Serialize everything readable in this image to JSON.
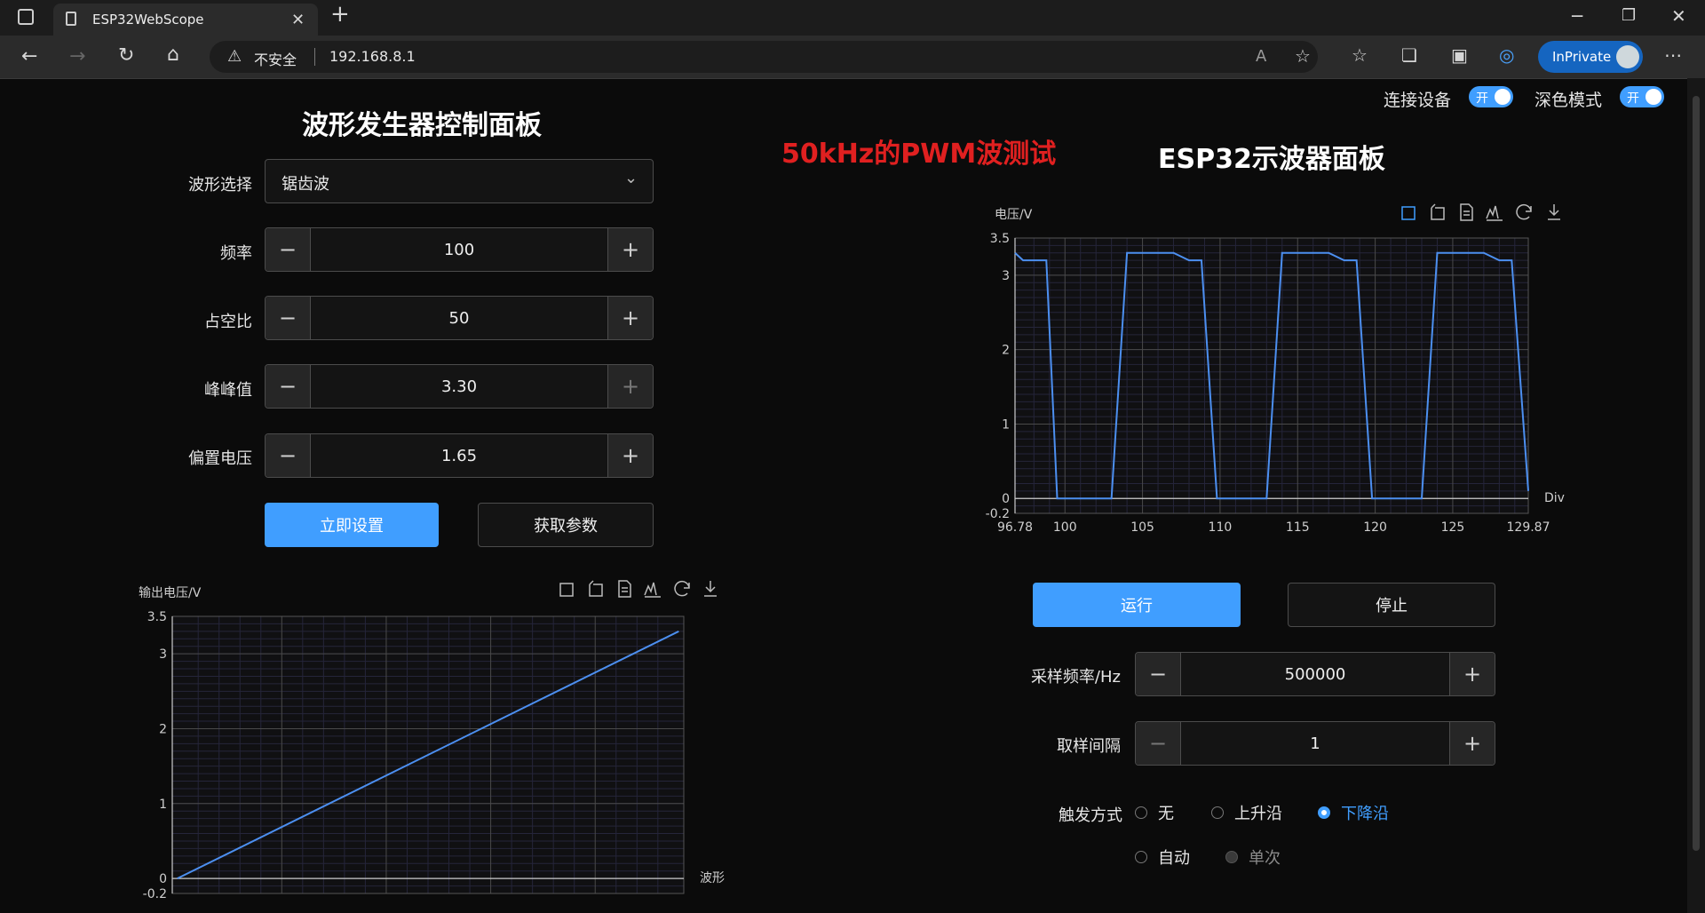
{
  "browser": {
    "tab_title": "ESP32WebScope",
    "new_tab": "+",
    "insecure_label": "不安全",
    "url": "192.168.8.1",
    "inprivate_label": "InPrivate"
  },
  "header": {
    "connect_label": "连接设备",
    "connect_toggle": "开",
    "dark_label": "深色模式",
    "dark_toggle": "开"
  },
  "annotation": {
    "text": "50kHz的PWM波测试",
    "color": "#e02020"
  },
  "generator": {
    "title": "波形发生器控制面板",
    "waveform_label": "波形选择",
    "waveform_value": "锯齿波",
    "freq_label": "频率",
    "freq_value": "100",
    "duty_label": "占空比",
    "duty_value": "50",
    "vpp_label": "峰峰值",
    "vpp_value": "3.30",
    "offset_label": "偏置电压",
    "offset_value": "1.65",
    "apply_button": "立即设置",
    "fetch_button": "获取参数",
    "minus": "−",
    "plus": "+"
  },
  "scope": {
    "title": "ESP32示波器面板",
    "run_button": "运行",
    "stop_button": "停止",
    "sample_rate_label": "采样频率/Hz",
    "sample_rate_value": "500000",
    "interval_label": "取样间隔",
    "interval_value": "1",
    "trigger_label": "触发方式",
    "trigger_options": [
      "无",
      "上升沿",
      "下降沿",
      "自动",
      "单次"
    ],
    "trigger_selected": "下降沿"
  },
  "colors": {
    "accent": "#409eff",
    "trace": "#4c8ff0"
  },
  "chart_data": [
    {
      "type": "line",
      "chart": "scope",
      "ylabel": "电压/V",
      "xlabel": "Div",
      "xlim": [
        96.78,
        129.87
      ],
      "ylim": [
        -0.2,
        3.5
      ],
      "x_ticks": [
        "96.78",
        "100",
        "105",
        "110",
        "115",
        "120",
        "125",
        "129.87"
      ],
      "y_ticks": [
        "3.5",
        "3",
        "2",
        "1",
        "0",
        "-0.2"
      ],
      "x": [
        96.78,
        97.3,
        97.8,
        98.8,
        99.5,
        100,
        101,
        102,
        103,
        104,
        105,
        106,
        107,
        108,
        108.8,
        109.8,
        110.5,
        111,
        112,
        113,
        114,
        115,
        116,
        117,
        118,
        118.8,
        119.8,
        120.5,
        121,
        122,
        123,
        124,
        125,
        126,
        127,
        128,
        128.8,
        129.87
      ],
      "y": [
        3.3,
        3.2,
        3.2,
        3.2,
        0,
        0,
        0,
        0,
        0,
        3.3,
        3.3,
        3.3,
        3.3,
        3.2,
        3.2,
        0,
        0,
        0,
        0,
        0,
        3.3,
        3.3,
        3.3,
        3.3,
        3.2,
        3.2,
        0,
        0,
        0,
        0,
        0,
        3.3,
        3.3,
        3.3,
        3.3,
        3.2,
        3.2,
        0.1
      ],
      "grid": true
    },
    {
      "type": "line",
      "chart": "generator",
      "ylabel": "输出电压/V",
      "xlabel": "波形",
      "ylim": [
        -0.2,
        3.5
      ],
      "y_ticks": [
        "3.5",
        "3",
        "2",
        "1",
        "0",
        "-0.2"
      ],
      "x": [
        0,
        1
      ],
      "y": [
        0,
        3.3
      ],
      "grid": true
    }
  ]
}
